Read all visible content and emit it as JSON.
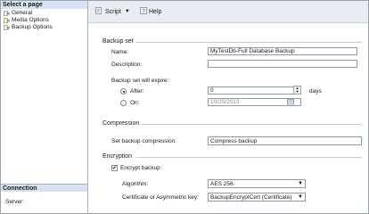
{
  "left_panel": {
    "title": "Select a page",
    "pages": [
      {
        "label": "General"
      },
      {
        "label": "Media Options"
      },
      {
        "label": "Backup Options"
      }
    ],
    "connection_title": "Connection",
    "server_label": "Server:"
  },
  "toolbar": {
    "script_label": "Script",
    "help_label": "Help"
  },
  "backup_set": {
    "title": "Backup set",
    "name_label": "Name:",
    "name_value": "MyTestDb-Full Database Backup",
    "description_label": "Description:",
    "description_value": "",
    "expire_label": "Backup set will expire:",
    "after_label": "After:",
    "after_value": "0",
    "days_label": "days",
    "on_label": "On:",
    "on_value": "10/25/2013"
  },
  "compression": {
    "title": "Compression",
    "set_label": "Set backup compression:",
    "set_value": "Compress backup"
  },
  "encryption": {
    "title": "Encryption",
    "encrypt_label": "Encrypt backup",
    "encrypt_checked": true,
    "algorithm_label": "Algorithm:",
    "algorithm_value": "AES 256",
    "cert_label": "Certificate or Asymmetric key:",
    "cert_value": "BackupEncryptCert (Certificate)"
  },
  "colors": {
    "panel_header": "#d7e3f1",
    "toolbar_bg": "#e9edf2",
    "border": "#8e9aa8"
  }
}
